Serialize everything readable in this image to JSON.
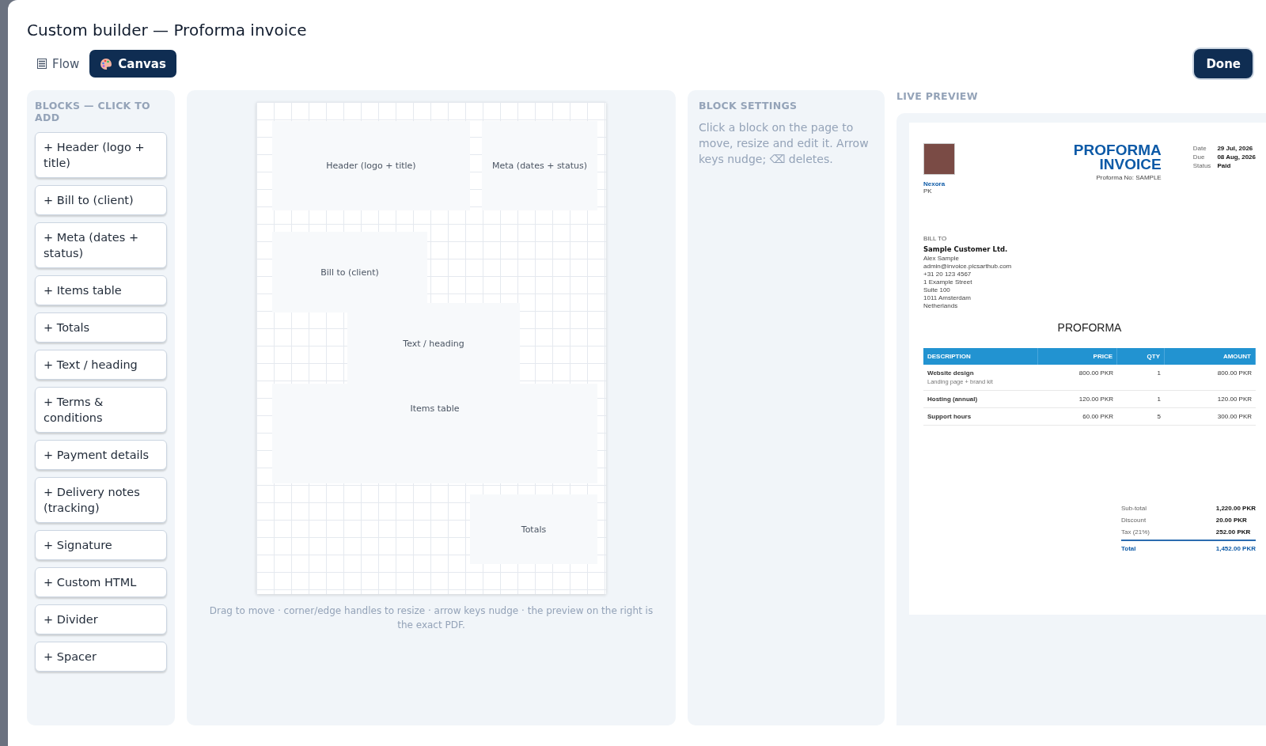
{
  "title": "Custom builder — Proforma invoice",
  "tabs": [
    {
      "label": "Flow",
      "kind": "list",
      "selected": false
    },
    {
      "label": "Canvas",
      "kind": "palette",
      "selected": true
    }
  ],
  "done_button": "Done",
  "blocks_panel": {
    "heading": "BLOCKS — CLICK TO ADD",
    "items": [
      "+ Header (logo + title)",
      "+ Bill to (client)",
      "+ Meta (dates + status)",
      "+ Items table",
      "+ Totals",
      "+ Text / heading",
      "+ Terms & conditions",
      "+ Payment details",
      "+ Delivery notes (tracking)",
      "+ Signature",
      "+ Custom HTML",
      "+ Divider",
      "+ Spacer"
    ]
  },
  "canvas": {
    "blocks": [
      {
        "label": "Header (logo + title)"
      },
      {
        "label": "Meta (dates + status)"
      },
      {
        "label": "Bill to (client)"
      },
      {
        "label": "Text / heading"
      },
      {
        "label": "Items table"
      },
      {
        "label": "Totals"
      }
    ],
    "hint": "Drag to move · corner/edge handles to resize · arrow keys nudge · the preview on the right is the exact PDF."
  },
  "block_settings": {
    "heading": "BLOCK SETTINGS",
    "text": "Click a block on the page to move, resize and edit it. Arrow keys nudge; ⌫ deletes."
  },
  "live_preview": {
    "heading": "LIVE PREVIEW",
    "document": {
      "company": "Nexora",
      "country": "PK",
      "title_lines": [
        "PROFORMA",
        "INVOICE"
      ],
      "number": "Proforma No: SAMPLE",
      "meta": [
        {
          "label": "Date",
          "value": "29 Jul, 2026"
        },
        {
          "label": "Due",
          "value": "08 Aug, 2026"
        },
        {
          "label": "Status",
          "value": "Paid"
        }
      ],
      "bill_to": {
        "heading": "BILL TO",
        "name": "Sample Customer Ltd.",
        "lines": [
          "Alex Sample",
          "admin@invoice.picsarthub.com",
          "+31 20 123 4567",
          "1 Example Street",
          "Suite 100",
          "1011 Amsterdam",
          "Netherlands"
        ]
      },
      "doc_heading": "PROFORMA",
      "columns": [
        "DESCRIPTION",
        "PRICE",
        "QTY",
        "AMOUNT"
      ],
      "rows": [
        {
          "description": "Website design",
          "note": "Landing page + brand kit",
          "price": "800.00 PKR",
          "qty": "1",
          "amount": "800.00 PKR"
        },
        {
          "description": "Hosting (annual)",
          "price": "120.00 PKR",
          "qty": "1",
          "amount": "120.00 PKR"
        },
        {
          "description": "Support hours",
          "price": "60.00 PKR",
          "qty": "5",
          "amount": "300.00 PKR"
        }
      ],
      "totals": [
        {
          "label": "Sub-total",
          "value": "1,220.00 PKR"
        },
        {
          "label": "Discount",
          "value": "20.00 PKR"
        },
        {
          "label": "Tax (21%)",
          "value": "252.00 PKR"
        }
      ],
      "grand_total": {
        "label": "Total",
        "value": "1,452.00 PKR"
      }
    }
  }
}
